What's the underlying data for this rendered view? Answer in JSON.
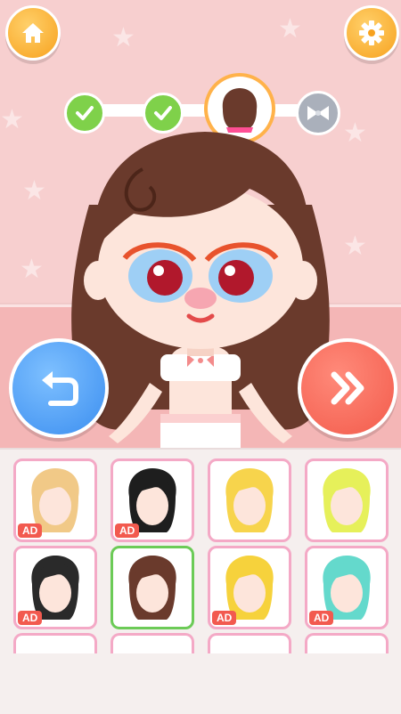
{
  "screen": {
    "title": ""
  },
  "top_bar": {
    "home_button": {
      "icon": "home-icon"
    },
    "settings_button": {
      "icon": "gear-icon"
    }
  },
  "progress_steps": [
    {
      "state": "completed",
      "icon": "checkmark-icon"
    },
    {
      "state": "completed",
      "icon": "checkmark-icon"
    },
    {
      "state": "current",
      "icon": "hair-icon"
    },
    {
      "state": "locked",
      "icon": "bow-icon"
    }
  ],
  "actions": {
    "undo_button": {
      "icon": "undo-icon"
    },
    "next_button": {
      "icon": "double-chevron-right-icon"
    }
  },
  "hair_options": [
    {
      "style": "blonde-wavy",
      "color": "#f1c987",
      "ad": "AD",
      "selected": false
    },
    {
      "style": "black-short",
      "color": "#1e1e1e",
      "ad": "AD",
      "selected": false
    },
    {
      "style": "golden-curly",
      "color": "#f7d44c",
      "ad": "",
      "selected": false
    },
    {
      "style": "lime-curly",
      "color": "#e6f05a",
      "ad": "",
      "selected": false
    },
    {
      "style": "black-pink-long",
      "color": "#2a2a2a",
      "ad": "AD",
      "selected": false
    },
    {
      "style": "brown-long",
      "color": "#6a3a2c",
      "ad": "",
      "selected": true
    },
    {
      "style": "yellow-pigtails",
      "color": "#f6d23c",
      "ad": "AD",
      "selected": false
    },
    {
      "style": "teal-pigtails",
      "color": "#64d9cc",
      "ad": "AD",
      "selected": false
    }
  ],
  "colors": {
    "accent_orange": "#f7a21f",
    "blue_button": "#3b8ef0",
    "red_button": "#f35b4b",
    "step_green": "#7fd14a",
    "item_border": "#f4a9c6",
    "selected_border": "#6ccb57"
  }
}
